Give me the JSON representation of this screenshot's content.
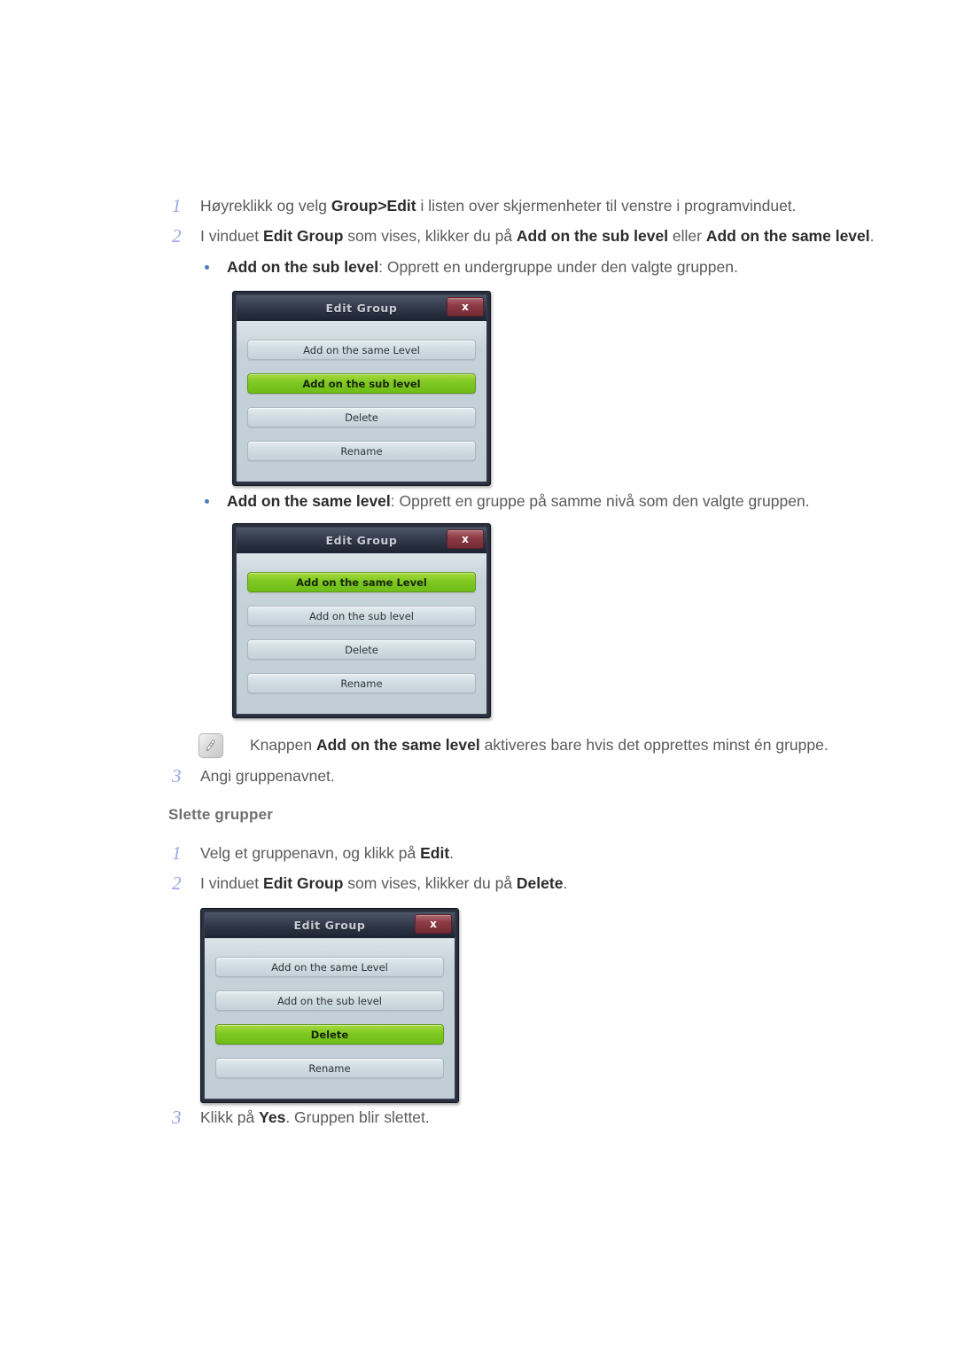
{
  "document": {
    "language": "no",
    "section_heading": "Slette grupper"
  },
  "colors": {
    "step_number": "#9aa6e6",
    "bullet": "#4a7ebb",
    "body_text": "#5a5a5c",
    "bold_text": "#2c2c2e",
    "dialog_selected_green": "#7fc822",
    "dialog_close_red": "#8e3c46",
    "dialog_frame": "#2b3040",
    "dialog_body": "#c6d2d9"
  },
  "steps_create": [
    {
      "number": "1",
      "parts": [
        {
          "t": "Høyreklikk og velg ",
          "b": false
        },
        {
          "t": "Group>Edit",
          "b": true
        },
        {
          "t": " i listen over skjermenheter til venstre i programvinduet.",
          "b": false
        }
      ]
    },
    {
      "number": "2",
      "parts": [
        {
          "t": "I vinduet ",
          "b": false
        },
        {
          "t": "Edit Group",
          "b": true
        },
        {
          "t": " som vises, klikker du på ",
          "b": false
        },
        {
          "t": "Add on the sub level",
          "b": true
        },
        {
          "t": " eller ",
          "b": false
        },
        {
          "t": "Add on the same level",
          "b": true
        },
        {
          "t": ".",
          "b": false
        }
      ]
    },
    {
      "number": "3",
      "parts": [
        {
          "t": "Angi gruppenavnet.",
          "b": false
        }
      ]
    }
  ],
  "bullets": [
    {
      "parts": [
        {
          "t": "Add on the sub level",
          "b": true
        },
        {
          "t": ": Opprett en undergruppe under den valgte gruppen.",
          "b": false
        }
      ]
    },
    {
      "parts": [
        {
          "t": "Add on the same level",
          "b": true
        },
        {
          "t": ": Opprett en gruppe på samme nivå som den valgte gruppen.",
          "b": false
        }
      ]
    }
  ],
  "note": {
    "icon": "note-pencil-icon",
    "parts": [
      {
        "t": "Knappen ",
        "b": false
      },
      {
        "t": "Add on the same level",
        "b": true
      },
      {
        "t": " aktiveres bare hvis det opprettes minst én gruppe.",
        "b": false
      }
    ]
  },
  "steps_delete": [
    {
      "number": "1",
      "parts": [
        {
          "t": "Velg et gruppenavn, og klikk på ",
          "b": false
        },
        {
          "t": "Edit",
          "b": true
        },
        {
          "t": ".",
          "b": false
        }
      ]
    },
    {
      "number": "2",
      "parts": [
        {
          "t": "I vinduet ",
          "b": false
        },
        {
          "t": "Edit Group",
          "b": true
        },
        {
          "t": " som vises, klikker du på ",
          "b": false
        },
        {
          "t": "Delete",
          "b": true
        },
        {
          "t": ".",
          "b": false
        }
      ]
    },
    {
      "number": "3",
      "parts": [
        {
          "t": "Klikk på ",
          "b": false
        },
        {
          "t": "Yes",
          "b": true
        },
        {
          "t": ". Gruppen blir slettet.",
          "b": false
        }
      ]
    }
  ],
  "dialogs": [
    {
      "id": "edit-group-sub-level",
      "title": "Edit Group",
      "close_label": "x",
      "buttons": [
        {
          "label": "Add on the same Level",
          "selected": false
        },
        {
          "label": "Add on the sub level",
          "selected": true
        },
        {
          "label": "Delete",
          "selected": false
        },
        {
          "label": "Rename",
          "selected": false
        }
      ]
    },
    {
      "id": "edit-group-same-level",
      "title": "Edit Group",
      "close_label": "x",
      "buttons": [
        {
          "label": "Add on the same Level",
          "selected": true
        },
        {
          "label": "Add on the sub level",
          "selected": false
        },
        {
          "label": "Delete",
          "selected": false
        },
        {
          "label": "Rename",
          "selected": false
        }
      ]
    },
    {
      "id": "edit-group-delete",
      "title": "Edit Group",
      "close_label": "x",
      "buttons": [
        {
          "label": "Add on the same Level",
          "selected": false
        },
        {
          "label": "Add on the sub level",
          "selected": false
        },
        {
          "label": "Delete",
          "selected": true
        },
        {
          "label": "Rename",
          "selected": false
        }
      ]
    }
  ]
}
